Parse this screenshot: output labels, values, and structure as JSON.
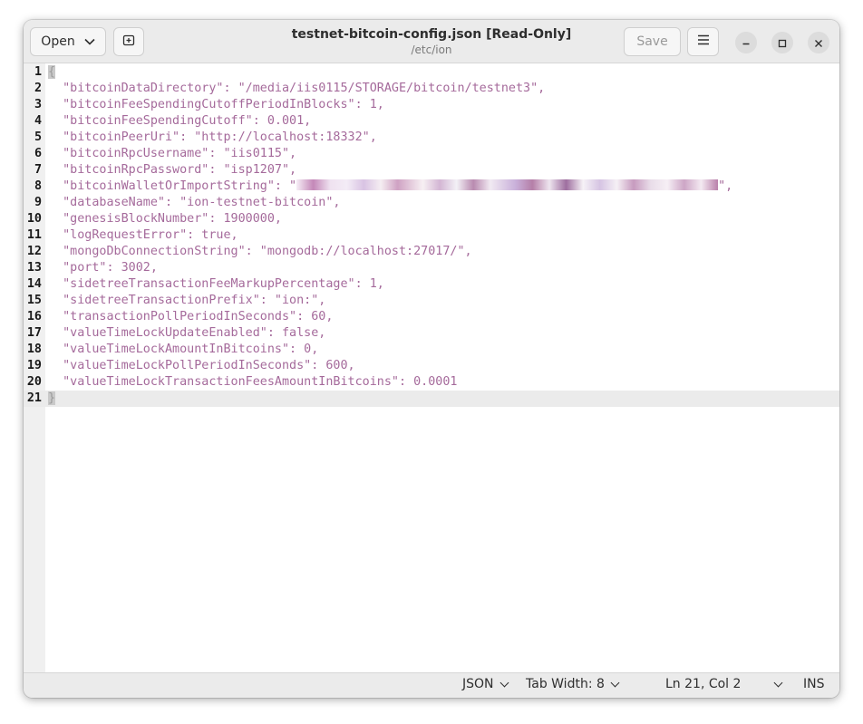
{
  "window": {
    "title": "testnet-bitcoin-config.json [Read-Only]",
    "subtitle": "/etc/ion"
  },
  "toolbar": {
    "open_label": "Open",
    "save_label": "Save",
    "icons": {
      "open_dropdown": "chevron-down-icon",
      "new_tab": "new-tab-icon",
      "menu": "hamburger-menu-icon",
      "minimize": "minimize-icon",
      "maximize": "maximize-icon",
      "close": "close-icon"
    }
  },
  "editor": {
    "string_color": "#a56a9b",
    "lines": [
      {
        "num": "1",
        "text": "{"
      },
      {
        "num": "2",
        "text": "  \"bitcoinDataDirectory\": \"/media/iis0115/STORAGE/bitcoin/testnet3\","
      },
      {
        "num": "3",
        "text": "  \"bitcoinFeeSpendingCutoffPeriodInBlocks\": 1,"
      },
      {
        "num": "4",
        "text": "  \"bitcoinFeeSpendingCutoff\": 0.001,"
      },
      {
        "num": "5",
        "text": "  \"bitcoinPeerUri\": \"http://localhost:18332\","
      },
      {
        "num": "6",
        "text": "  \"bitcoinRpcUsername\": \"iis0115\","
      },
      {
        "num": "7",
        "text": "  \"bitcoinRpcPassword\": \"isp1207\","
      },
      {
        "num": "8",
        "text_before": "  \"bitcoinWalletOrImportString\": \"",
        "text_after": "\","
      },
      {
        "num": "9",
        "text": "  \"databaseName\": \"ion-testnet-bitcoin\","
      },
      {
        "num": "10",
        "text": "  \"genesisBlockNumber\": 1900000,"
      },
      {
        "num": "11",
        "text": "  \"logRequestError\": true,"
      },
      {
        "num": "12",
        "text": "  \"mongoDbConnectionString\": \"mongodb://localhost:27017/\","
      },
      {
        "num": "13",
        "text": "  \"port\": 3002,"
      },
      {
        "num": "14",
        "text": "  \"sidetreeTransactionFeeMarkupPercentage\": 1,"
      },
      {
        "num": "15",
        "text": "  \"sidetreeTransactionPrefix\": \"ion:\","
      },
      {
        "num": "16",
        "text": "  \"transactionPollPeriodInSeconds\": 60,"
      },
      {
        "num": "17",
        "text": "  \"valueTimeLockUpdateEnabled\": false,"
      },
      {
        "num": "18",
        "text": "  \"valueTimeLockAmountInBitcoins\": 0,"
      },
      {
        "num": "19",
        "text": "  \"valueTimeLockPollPeriodInSeconds\": 600,"
      },
      {
        "num": "20",
        "text": "  \"valueTimeLockTransactionFeesAmountInBitcoins\": 0.0001"
      },
      {
        "num": "21",
        "text": "}"
      }
    ]
  },
  "statusbar": {
    "language": "JSON",
    "tab_width": "Tab Width: 8",
    "position": "Ln 21, Col 2",
    "mode": "INS"
  }
}
